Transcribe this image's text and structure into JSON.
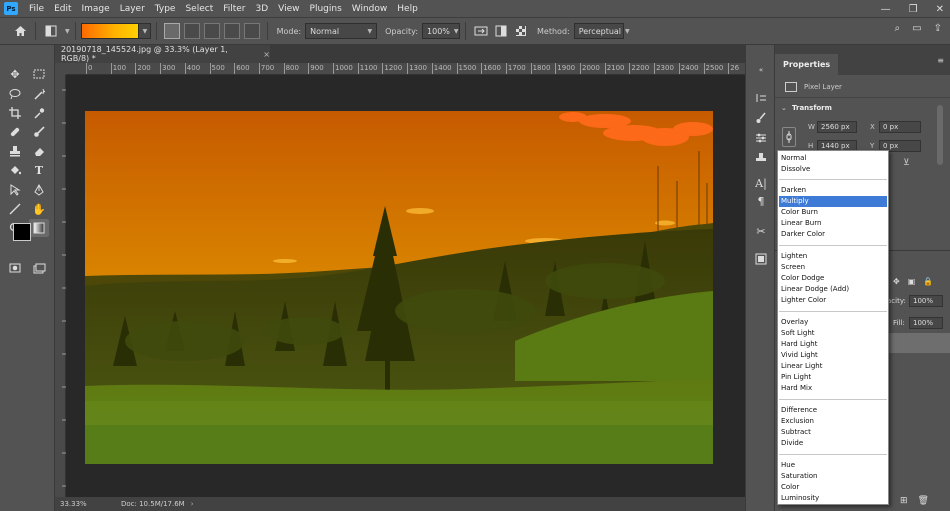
{
  "app": {
    "logo": "Ps",
    "menus": [
      "File",
      "Edit",
      "Image",
      "Layer",
      "Type",
      "Select",
      "Filter",
      "3D",
      "View",
      "Plugins",
      "Window",
      "Help"
    ]
  },
  "window_controls": [
    "—",
    "❐",
    "✕"
  ],
  "options_bar": {
    "mode_label": "Mode:",
    "mode_value": "Normal",
    "opacity_label": "Opacity:",
    "opacity_value": "100%",
    "method_label": "Method:",
    "method_value": "Perceptual"
  },
  "document": {
    "tab_title": "20190718_145524.jpg @ 33.3% (Layer 1, RGB/8) *",
    "tab_close": "×",
    "ruler_marks": [
      "0",
      "100",
      "200",
      "300",
      "400",
      "500",
      "600",
      "700",
      "800",
      "900",
      "1000",
      "1100",
      "1200",
      "1300",
      "1400",
      "1500",
      "1600",
      "1700",
      "1800",
      "1900",
      "2000",
      "2100",
      "2200",
      "2300",
      "2400",
      "2500",
      "26"
    ]
  },
  "status": {
    "zoom": "33.33%",
    "doc_info": "Doc: 10.5M/17.6M"
  },
  "properties": {
    "tab": "Properties",
    "layer_type": "Pixel Layer",
    "section": "Transform",
    "w_label": "W",
    "w_value": "2560 px",
    "h_label": "H",
    "h_value": "1440 px",
    "x_label": "X",
    "x_value": "0 px",
    "y_label": "Y",
    "y_value": "0 px"
  },
  "layers": {
    "opacity_label": "acity:",
    "opacity_value": "100%",
    "fill_label": "Fill:",
    "fill_value": "100%"
  },
  "blend_menu": {
    "groups": [
      [
        "Normal",
        "Dissolve"
      ],
      [
        "Darken",
        "Multiply",
        "Color Burn",
        "Linear Burn",
        "Darker Color"
      ],
      [
        "Lighten",
        "Screen",
        "Color Dodge",
        "Linear Dodge (Add)",
        "Lighter Color"
      ],
      [
        "Overlay",
        "Soft Light",
        "Hard Light",
        "Vivid Light",
        "Linear Light",
        "Pin Light",
        "Hard Mix"
      ],
      [
        "Difference",
        "Exclusion",
        "Subtract",
        "Divide"
      ],
      [
        "Hue",
        "Saturation",
        "Color",
        "Luminosity"
      ]
    ],
    "selected": "Multiply"
  },
  "colors": {
    "accent": "#3e7bd6",
    "ps_blue": "#31a8ff",
    "ui_bg": "#535353"
  },
  "icons": {
    "home": "home-icon",
    "tools": [
      "move-icon",
      "marquee-icon",
      "lasso-icon",
      "magic-wand-icon",
      "crop-icon",
      "eyedropper-icon",
      "healing-icon",
      "brush-icon",
      "stamp-icon",
      "eraser-icon",
      "paint-bucket-icon",
      "type-icon",
      "path-select-icon",
      "pen-icon",
      "line-icon",
      "hand-icon",
      "zoom-icon",
      "gradient-icon",
      "quickmask-icon",
      "screen-mode-icon"
    ]
  }
}
